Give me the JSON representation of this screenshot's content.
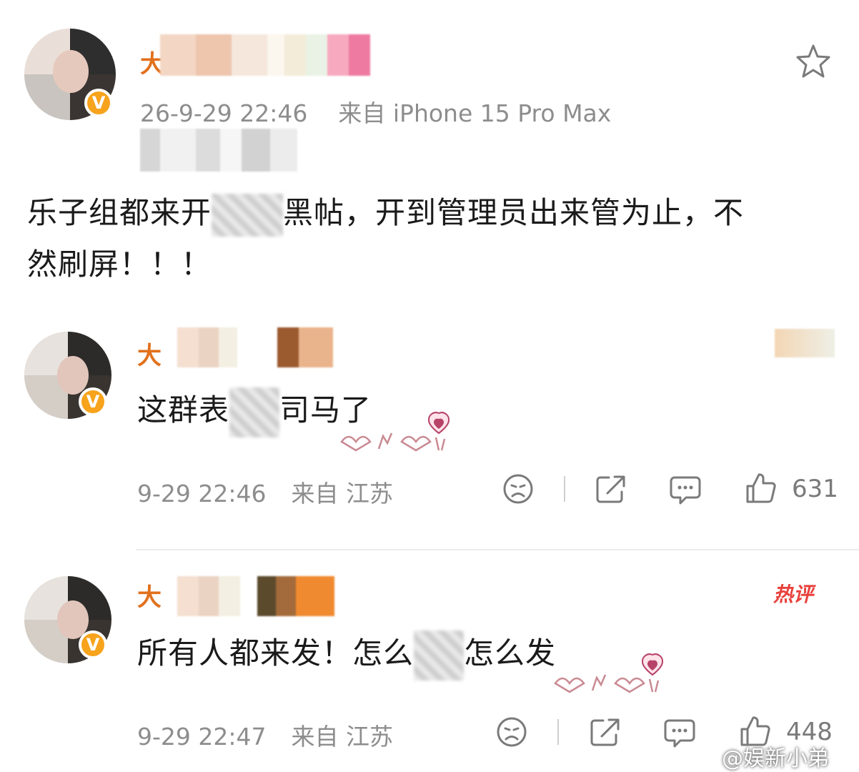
{
  "post": {
    "author_first_char": "大",
    "meta_time": "26-9-29 22:46",
    "meta_from": "来自 iPhone 15 Pro Max",
    "body_part1": "乐子组都来开",
    "body_part2": "黑帖，开到管理员出来管为止，不",
    "body_line2": "然刷屏！！！",
    "star_icon": "star-outline-icon"
  },
  "comments": [
    {
      "author_first_char": "大",
      "text_part1": "这群表",
      "text_part2": "司马了",
      "time": "9-29 22:46",
      "from": "来自 江苏",
      "likes": "631"
    },
    {
      "author_first_char": "大",
      "badge": "热评",
      "text_part1": "所有人都来发！怎么",
      "text_part2": "怎么发",
      "time": "9-29 22:47",
      "from": "来自 江苏",
      "likes": "448"
    }
  ],
  "watermark": "@娱新小弟",
  "colors": {
    "name_orange": "#e1711d",
    "verified_gold": "#f7a31c",
    "meta_gray": "#8d8d8d",
    "hot_red": "#e8413c"
  }
}
